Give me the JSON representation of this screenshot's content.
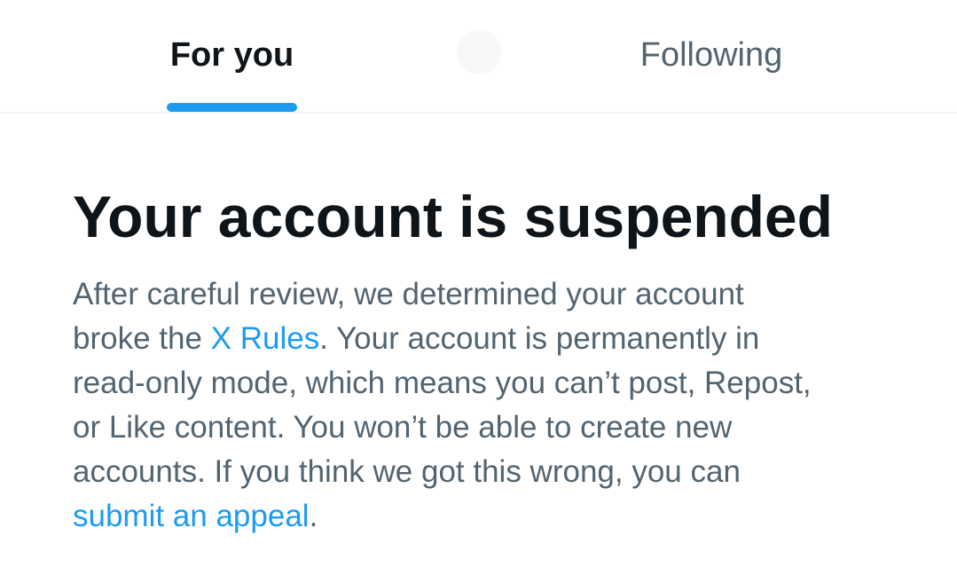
{
  "tabs": {
    "for_you": "For you",
    "following": "Following"
  },
  "notice": {
    "title": "Your account is suspended",
    "line1": "After careful review, we determined your account",
    "line2_prefix": "broke the ",
    "rules_link": "X Rules",
    "line2_suffix": ". Your account is permanently in",
    "line3": "read-only mode, which means you can’t post, Repost,",
    "line4": "or Like content. You won’t be able to create new",
    "line5": "accounts. If you think we got this wrong, you can",
    "appeal_link": "submit an appeal",
    "line6_suffix": "."
  },
  "colors": {
    "accent": "#1d9bf0",
    "primary_text": "#0f1419",
    "secondary_text": "#536471",
    "divider": "#eff3f4"
  },
  "icons": {
    "center": "x-logo-icon"
  }
}
